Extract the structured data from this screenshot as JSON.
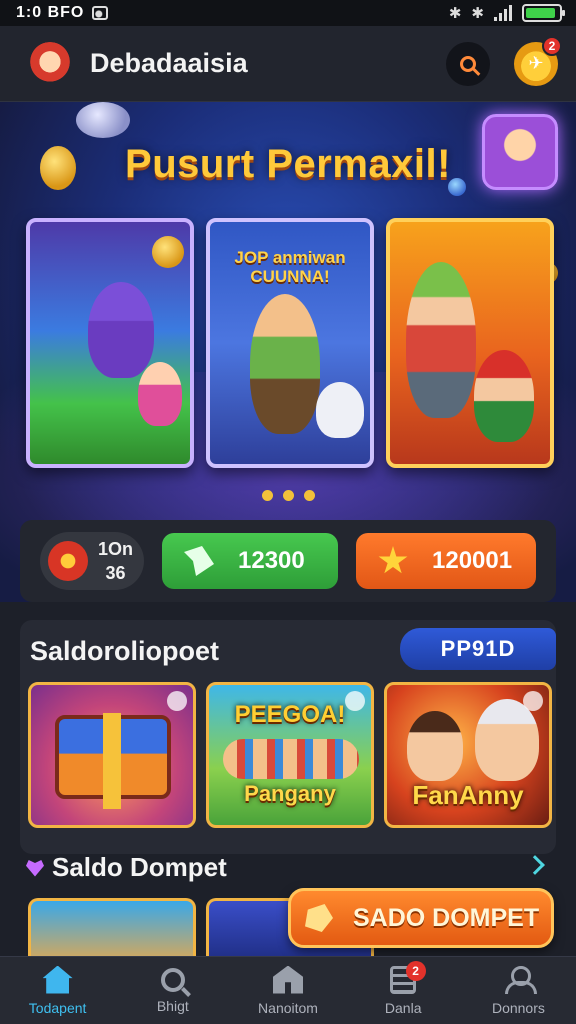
{
  "status_bar": {
    "time": "1:0 BFO",
    "icons": [
      "image-icon",
      "bluetooth-icon",
      "signal-icon",
      "battery-icon"
    ],
    "battery_level": 0.9
  },
  "header": {
    "title": "Debadaaisia",
    "icons": [
      "avatar-logo-icon",
      "search-icon",
      "notification-icon"
    ],
    "notification_count": "2"
  },
  "hero": {
    "title": "Pusurt Permaxil!",
    "card_caption": "JOP anmiwan CUUNNA!",
    "stats_badge": {
      "line1": "1On",
      "line2": "36"
    },
    "green_value": "12300",
    "orange_value": "120001",
    "colors": {
      "title": "#ffc93a",
      "green": "#47c84f",
      "orange": "#ff7a2c"
    }
  },
  "section": {
    "title": "Saldoroliopoet",
    "badge": "PP91D",
    "thumbs": [
      {
        "label": ""
      },
      {
        "label_top": "PEEGOA!",
        "label_bottom": "Pangany"
      },
      {
        "label": "FanAnny"
      }
    ]
  },
  "section2": {
    "title": "Saldo Dompet",
    "cta": "SADO DOMPET"
  },
  "bottom_nav": {
    "items": [
      {
        "label": "Todapent",
        "icon": "home-icon",
        "active": true
      },
      {
        "label": "Bhigt",
        "icon": "search-icon"
      },
      {
        "label": "Nanoitom",
        "icon": "store-icon"
      },
      {
        "label": "Danla",
        "icon": "message-icon",
        "badge": "2"
      },
      {
        "label": "Donnors",
        "icon": "user-icon"
      }
    ]
  }
}
